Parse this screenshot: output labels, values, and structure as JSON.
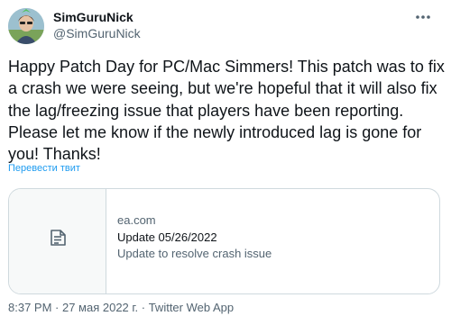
{
  "tweet": {
    "display_name": "SimGuruNick",
    "handle": "@SimGuruNick",
    "text": "Happy Patch Day for PC/Mac Simmers! This patch was to fix a crash we were seeing, but we're hopeful that it will also fix the lag/freezing issue that players have been reporting. Please let me know if the newly introduced lag is gone for you! Thanks!",
    "translate_label": "Перевести твит",
    "timestamp": "8:37 PM · 27 мая 2022 г. · Twitter Web App"
  },
  "card": {
    "domain": "ea.com",
    "title": "Update 05/26/2022",
    "description": "Update to resolve crash issue",
    "icon": "document-icon"
  },
  "icons": {
    "more": "more-horizontal-icon"
  },
  "colors": {
    "link": "#1d9bf0",
    "secondary_text": "#536471",
    "border": "#cfd9de"
  }
}
